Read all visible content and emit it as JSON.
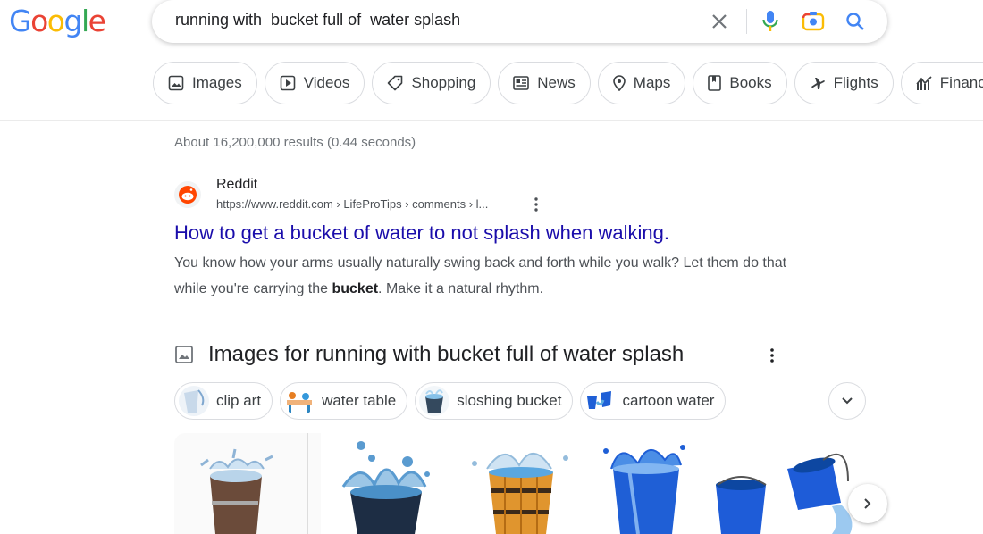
{
  "logo": {
    "letters": [
      "G",
      "o",
      "o",
      "g",
      "l",
      "e"
    ],
    "colors": [
      "#4285f4",
      "#ea4335",
      "#fbbc05",
      "#4285f4",
      "#34a853",
      "#ea4335"
    ]
  },
  "search": {
    "query": "running with  bucket full of  water splash"
  },
  "tabs": [
    {
      "label": "Images",
      "icon": "image-icon"
    },
    {
      "label": "Videos",
      "icon": "video-icon"
    },
    {
      "label": "Shopping",
      "icon": "tag-icon"
    },
    {
      "label": "News",
      "icon": "news-icon"
    },
    {
      "label": "Maps",
      "icon": "map-pin-icon"
    },
    {
      "label": "Books",
      "icon": "book-icon"
    },
    {
      "label": "Flights",
      "icon": "plane-icon"
    },
    {
      "label": "Finance",
      "icon": "finance-icon"
    }
  ],
  "result_stats": "About 16,200,000 results (0.44 seconds)",
  "result": {
    "site": "Reddit",
    "url": "https://www.reddit.com › LifeProTips › comments › l...",
    "title": "How to get a bucket of water to not splash when walking.",
    "snippet_line1": "You know how your arms usually naturally swing back and forth while you walk? Let them do that",
    "snippet_line2_pre": "while you're carrying the ",
    "snippet_bold": "bucket",
    "snippet_line2_post": ". Make it a natural rhythm."
  },
  "images_section": {
    "heading": "Images for running with bucket full of water splash",
    "refinements": [
      "clip art",
      "water table",
      "sloshing bucket",
      "cartoon water"
    ]
  },
  "colors": {
    "link": "#1a0dab",
    "accent_blue": "#4285f4"
  }
}
